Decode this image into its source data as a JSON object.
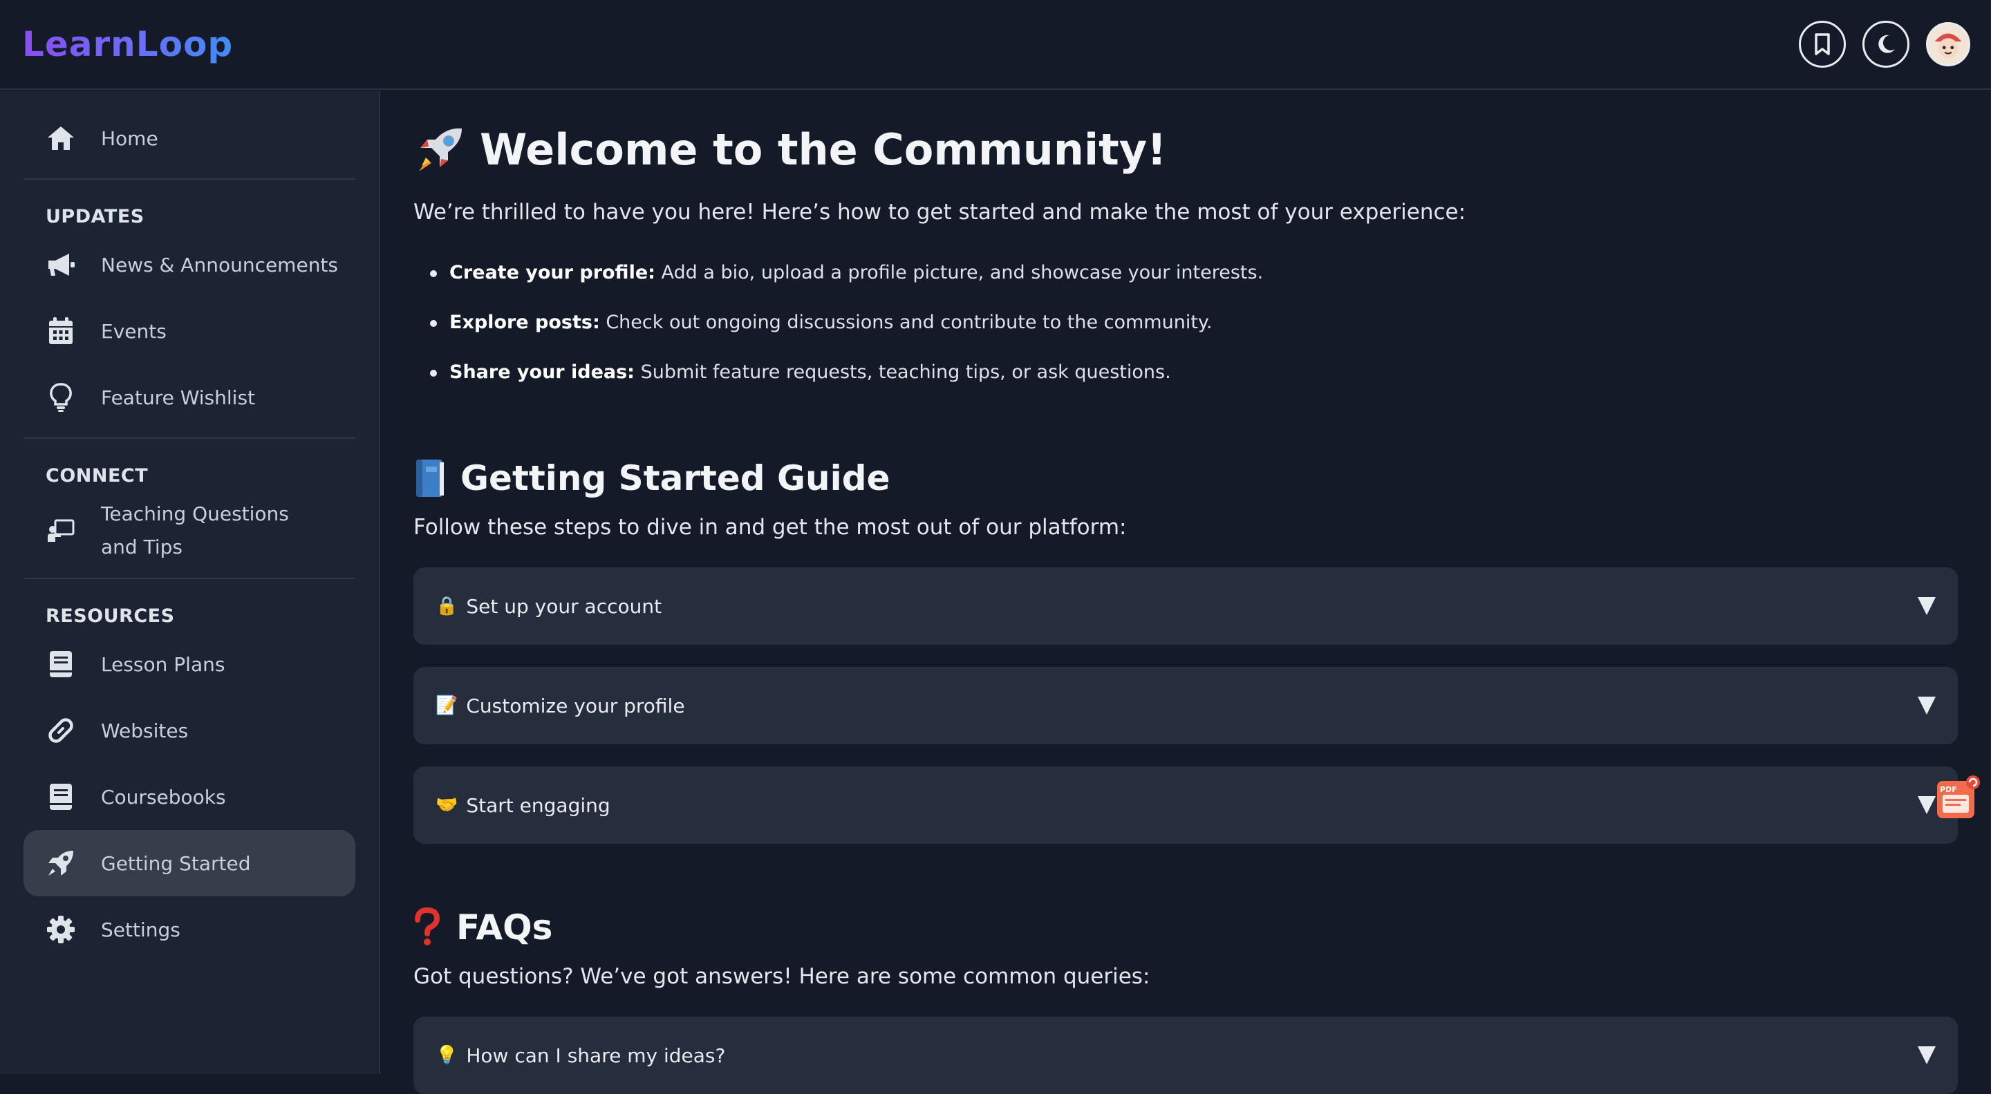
{
  "header": {
    "logo": "LearnLoop",
    "bookmark_icon": "bookmark-icon",
    "theme_icon": "moon-icon",
    "avatar_icon": "avatar"
  },
  "sidebar": {
    "home": "Home",
    "sections": {
      "updates": "UPDATES",
      "connect": "CONNECT",
      "resources": "RESOURCES"
    },
    "items": {
      "news": "News & Announcements",
      "events": "Events",
      "wishlist": "Feature Wishlist",
      "teaching": "Teaching Questions and Tips",
      "lessons": "Lesson Plans",
      "websites": "Websites",
      "coursebooks": "Coursebooks",
      "getting_started": "Getting Started",
      "settings": "Settings"
    }
  },
  "main": {
    "welcome_title": "Welcome to the Community!",
    "welcome_lead": "We’re thrilled to have you here! Here’s how to get started and make the most of your experience:",
    "bullets": [
      {
        "bold": "Create your profile:",
        "text": " Add a bio, upload a profile picture, and showcase your interests."
      },
      {
        "bold": "Explore posts:",
        "text": " Check out ongoing discussions and contribute to the community."
      },
      {
        "bold": "Share your ideas:",
        "text": " Submit feature requests, teaching tips, or ask questions."
      }
    ],
    "guide_title": "Getting Started Guide",
    "guide_lead": "Follow these steps to dive in and get the most out of our platform:",
    "guide_items": [
      {
        "emoji": "🔒",
        "label": "Set up your account"
      },
      {
        "emoji": "📝",
        "label": "Customize your profile"
      },
      {
        "emoji": "🤝",
        "label": "Start engaging"
      }
    ],
    "faq_title": "FAQs",
    "faq_lead": "Got questions? We’ve got answers! Here are some common queries:",
    "faq_items": [
      {
        "emoji": "💡",
        "label": "How can I share my ideas?"
      }
    ]
  },
  "colors": {
    "background": "#141a27",
    "sidebar": "#1c2433",
    "card": "#262e3d",
    "active": "#363d4b",
    "logo_gradient_start": "#8a4cf0",
    "logo_gradient_end": "#3f8df8"
  }
}
